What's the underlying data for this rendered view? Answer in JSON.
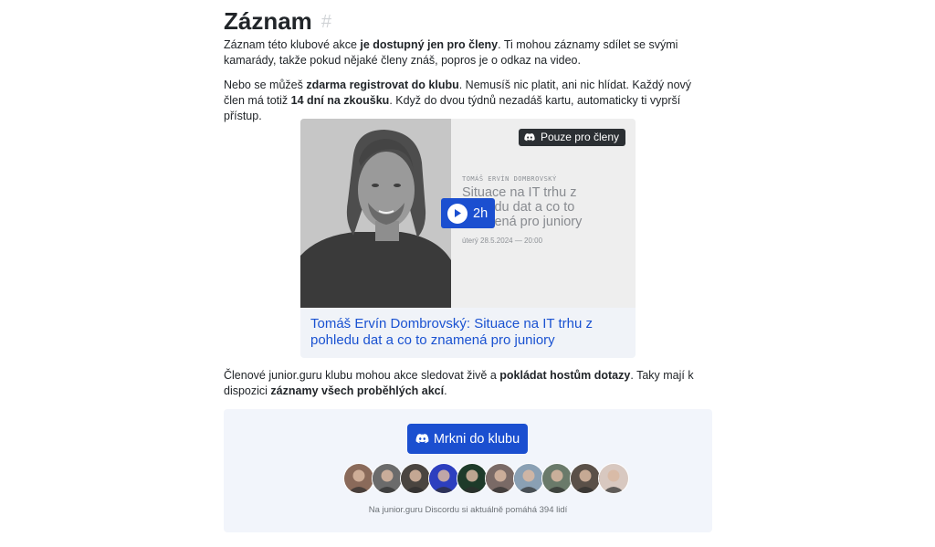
{
  "heading": {
    "title": "Záznam",
    "anchor": "#"
  },
  "intro": {
    "p1_a": "Záznam této klubové akce ",
    "p1_b": "je dostupný jen pro členy",
    "p1_c": ". Ti mohou záznamy sdílet se svými kamarády, takže pokud nějaké členy znáš, popros je o odkaz na video.",
    "p2_a": "Nebo se můžeš ",
    "p2_b": "zdarma registrovat do klubu",
    "p2_c": ". Nemusíš nic platit, ani nic hlídat. Každý nový člen má totiž ",
    "p2_d": "14 dní na zkoušku",
    "p2_e": ". Když do dvou týdnů nezadáš kartu, automaticky ti vyprší přístup."
  },
  "video": {
    "badge": "Pouze pro členy",
    "speaker_upper": "TOMÁŠ ERVÍN DOMBROVSKÝ",
    "talk_title": "Situace na IT trhu z pohledu dat a co to znamená pro juniory",
    "talk_date": "úterý 28.5.2024 — 20:00",
    "duration": "2h",
    "link_text": "Tomáš Ervín Dombrovský: Situace na IT trhu z pohledu dat a co to znamená pro juniory",
    "icons": {
      "badge": "discord-icon",
      "play": "play-icon"
    }
  },
  "members": {
    "p3_a": "Členové junior.guru klubu mohou akce sledovat živě a ",
    "p3_b": "pokládat hostům dotazy",
    "p3_c": ". Taky mají k dispozici ",
    "p3_d": "záznamy všech proběhlých akcí",
    "p3_e": "."
  },
  "club": {
    "button_label": "Mrkni do klubu",
    "button_icon": "discord-icon",
    "note": "Na junior.guru Discordu si aktuálně pomáhá 394 lidí",
    "avatars": [
      "#8a6a5a",
      "#6b6b6b",
      "#4a4540",
      "#2d3fbf",
      "#1e3b2a",
      "#7a6a66",
      "#8aa0b4",
      "#6a7a6a",
      "#5a5048",
      "#d8c8c0"
    ]
  },
  "colors": {
    "accent": "#1b4fd0",
    "link": "#1a52d1",
    "box_bg": "#f2f5fb"
  }
}
